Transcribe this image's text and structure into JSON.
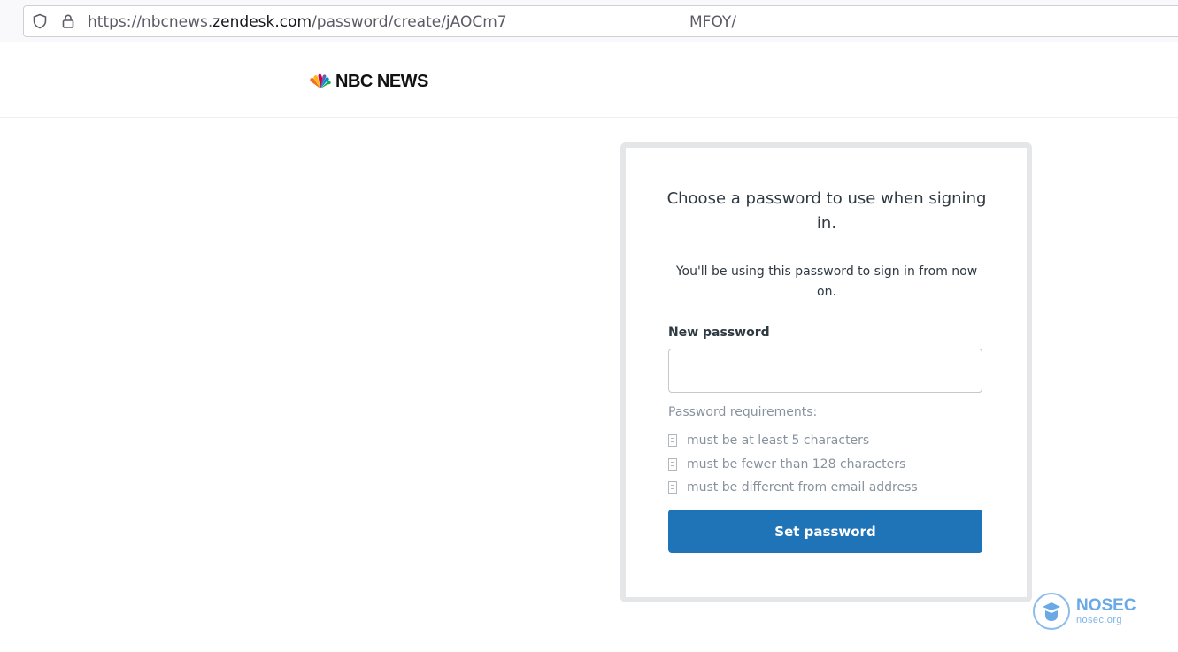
{
  "browser": {
    "url_prefix": "https://nbcnews.",
    "url_domain": "zendesk.com",
    "url_path": "/password/create/jAOCm7",
    "url_tail": "MFOY/",
    "icons": [
      "shield-icon",
      "lock-icon"
    ]
  },
  "header": {
    "logo_text": "NBC NEWS"
  },
  "card": {
    "title": "Choose a password to use when signing in.",
    "subtitle": "You'll be using this password to sign in from now on.",
    "field_label": "New password",
    "field_value": "",
    "requirements_title": "Password requirements:",
    "requirements": [
      "must be at least 5 characters",
      "must be fewer than 128 characters",
      "must be different from email address"
    ],
    "submit_label": "Set password"
  },
  "watermark": {
    "name": "NOSEC",
    "site": "nosec.org"
  },
  "colors": {
    "button": "#1f73b7",
    "card_border": "#e4e6e8",
    "muted_text": "#87929d",
    "watermark": "#6aa9e6"
  }
}
